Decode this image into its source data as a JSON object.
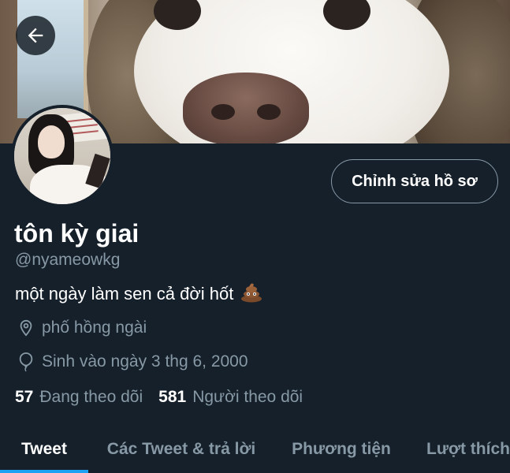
{
  "header": {
    "back_icon": "arrow-left-icon"
  },
  "profile": {
    "display_name": "tôn kỳ giai",
    "handle": "@nyameowkg",
    "bio": "một ngày làm sen cả đời hốt",
    "bio_emoji": "pile-of-poo-icon",
    "location_icon": "location-pin-icon",
    "location": "phố hồng ngài",
    "birthday_icon": "balloon-icon",
    "birthday": "Sinh vào ngày 3 thg 6, 2000",
    "following_count": "57",
    "following_label": "Đang theo dõi",
    "followers_count": "581",
    "followers_label": "Người theo dõi"
  },
  "actions": {
    "edit_profile_label": "Chỉnh sửa hồ sơ"
  },
  "tabs": [
    {
      "label": "Tweet",
      "active": true
    },
    {
      "label": "Các Tweet & trả lời",
      "active": false
    },
    {
      "label": "Phương tiện",
      "active": false
    },
    {
      "label": "Lượt thích",
      "active": false
    }
  ],
  "colors": {
    "background": "#15202b",
    "secondary_text": "#8899a6",
    "accent": "#1da1f2",
    "primary_text": "#ffffff"
  }
}
